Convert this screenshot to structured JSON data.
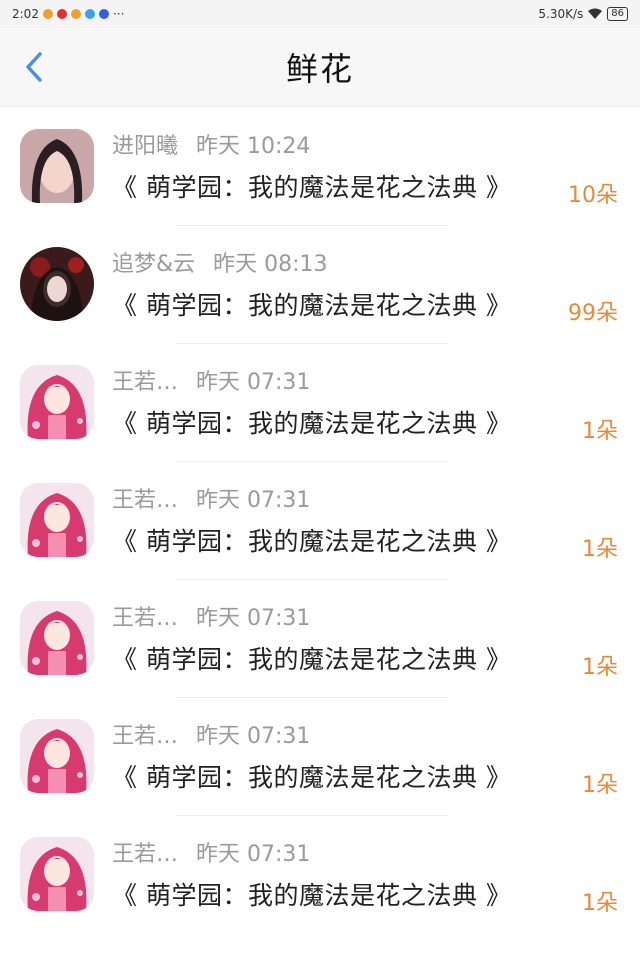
{
  "status_bar": {
    "time": "2:02",
    "network_speed": "5.30K/s",
    "battery": "86",
    "more": "···"
  },
  "header": {
    "title": "鲜花"
  },
  "items": [
    {
      "name": "进阳曦",
      "time": "昨天 10:24",
      "book": "《 萌学园：我的魔法是花之法典 》",
      "count": "10朵",
      "avatar_shape": "rounded",
      "avatar_style": "photo"
    },
    {
      "name": "追梦&云",
      "time": "昨天 08:13",
      "book": "《 萌学园：我的魔法是花之法典 》",
      "count": "99朵",
      "avatar_shape": "circle",
      "avatar_style": "dark-art"
    },
    {
      "name": "王若…",
      "time": "昨天 07:31",
      "book": "《 萌学园：我的魔法是花之法典 》",
      "count": "1朵",
      "avatar_shape": "rounded",
      "avatar_style": "anime"
    },
    {
      "name": "王若…",
      "time": "昨天 07:31",
      "book": "《 萌学园：我的魔法是花之法典 》",
      "count": "1朵",
      "avatar_shape": "rounded",
      "avatar_style": "anime"
    },
    {
      "name": "王若…",
      "time": "昨天 07:31",
      "book": "《 萌学园：我的魔法是花之法典 》",
      "count": "1朵",
      "avatar_shape": "rounded",
      "avatar_style": "anime"
    },
    {
      "name": "王若…",
      "time": "昨天 07:31",
      "book": "《 萌学园：我的魔法是花之法典 》",
      "count": "1朵",
      "avatar_shape": "rounded",
      "avatar_style": "anime"
    },
    {
      "name": "王若…",
      "time": "昨天 07:31",
      "book": "《 萌学园：我的魔法是花之法典 》",
      "count": "1朵",
      "avatar_shape": "rounded",
      "avatar_style": "anime"
    }
  ],
  "colors": {
    "accent": "#4a90e2",
    "count": "#e8893a",
    "meta": "#9a9a9a"
  }
}
